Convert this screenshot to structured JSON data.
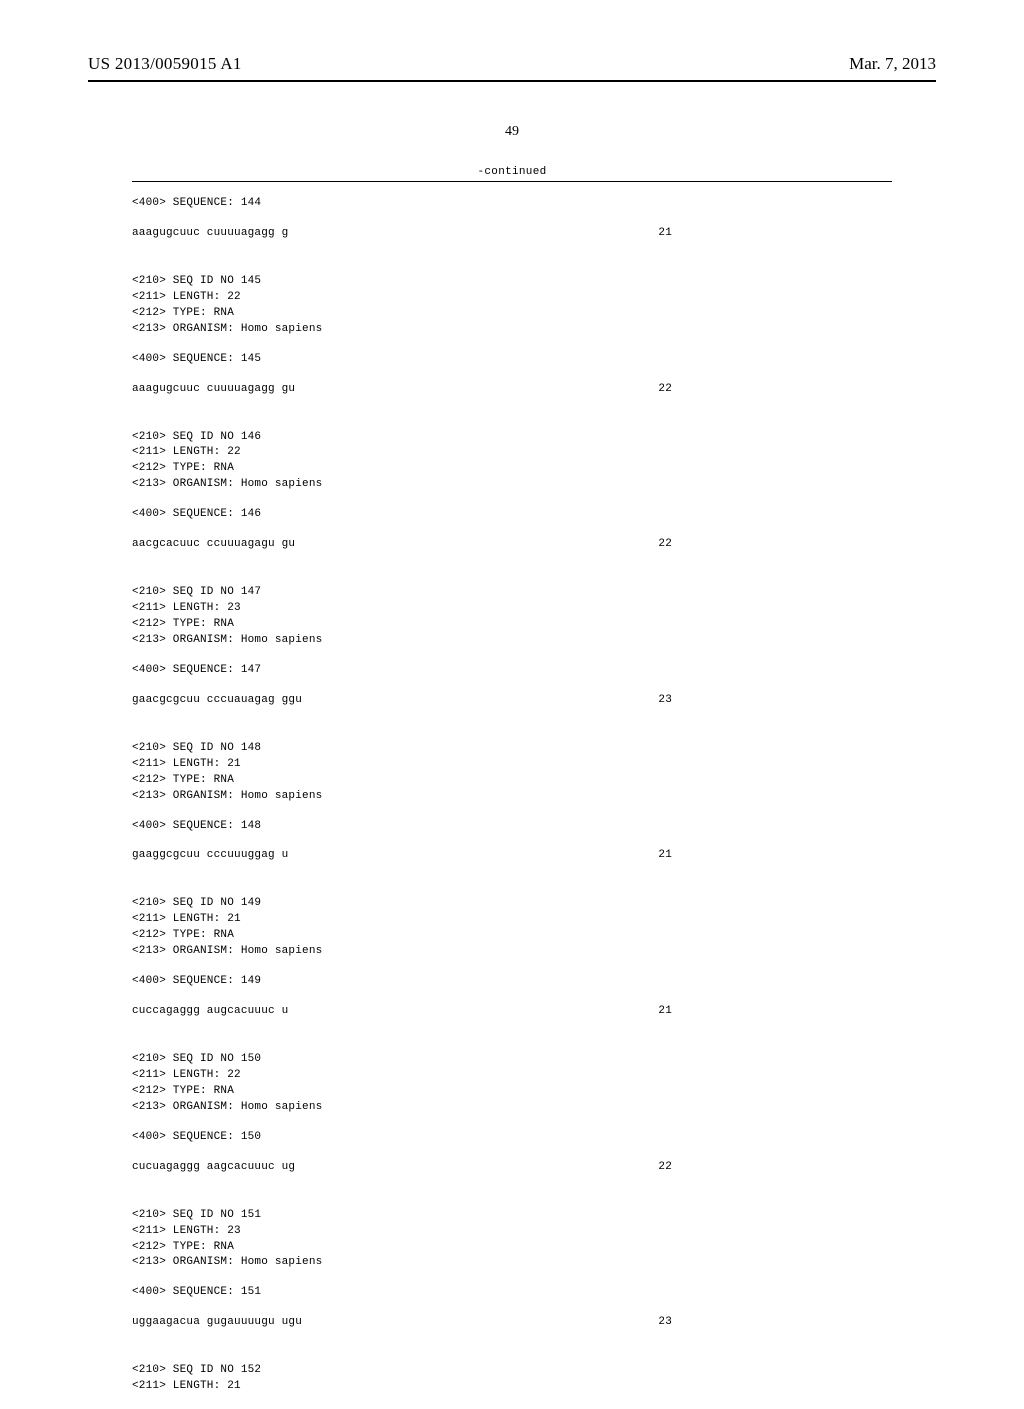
{
  "header": {
    "publication_number": "US 2013/0059015 A1",
    "publication_date": "Mar. 7, 2013"
  },
  "page_number": "49",
  "continued_label": "-continued",
  "entries": [
    {
      "seq_400_header": "<400> SEQUENCE: 144",
      "sequence_text": "aaagugcuuc cuuuuagagg g",
      "sequence_length": "21"
    },
    {
      "meta": [
        "<210> SEQ ID NO 145",
        "<211> LENGTH: 22",
        "<212> TYPE: RNA",
        "<213> ORGANISM: Homo sapiens"
      ],
      "seq_400_header": "<400> SEQUENCE: 145",
      "sequence_text": "aaagugcuuc cuuuuagagg gu",
      "sequence_length": "22"
    },
    {
      "meta": [
        "<210> SEQ ID NO 146",
        "<211> LENGTH: 22",
        "<212> TYPE: RNA",
        "<213> ORGANISM: Homo sapiens"
      ],
      "seq_400_header": "<400> SEQUENCE: 146",
      "sequence_text": "aacgcacuuc ccuuuagagu gu",
      "sequence_length": "22"
    },
    {
      "meta": [
        "<210> SEQ ID NO 147",
        "<211> LENGTH: 23",
        "<212> TYPE: RNA",
        "<213> ORGANISM: Homo sapiens"
      ],
      "seq_400_header": "<400> SEQUENCE: 147",
      "sequence_text": "gaacgcgcuu cccuauagag ggu",
      "sequence_length": "23"
    },
    {
      "meta": [
        "<210> SEQ ID NO 148",
        "<211> LENGTH: 21",
        "<212> TYPE: RNA",
        "<213> ORGANISM: Homo sapiens"
      ],
      "seq_400_header": "<400> SEQUENCE: 148",
      "sequence_text": "gaaggcgcuu cccuuuggag u",
      "sequence_length": "21"
    },
    {
      "meta": [
        "<210> SEQ ID NO 149",
        "<211> LENGTH: 21",
        "<212> TYPE: RNA",
        "<213> ORGANISM: Homo sapiens"
      ],
      "seq_400_header": "<400> SEQUENCE: 149",
      "sequence_text": "cuccagaggg augcacuuuc u",
      "sequence_length": "21"
    },
    {
      "meta": [
        "<210> SEQ ID NO 150",
        "<211> LENGTH: 22",
        "<212> TYPE: RNA",
        "<213> ORGANISM: Homo sapiens"
      ],
      "seq_400_header": "<400> SEQUENCE: 150",
      "sequence_text": "cucuagaggg aagcacuuuc ug",
      "sequence_length": "22"
    },
    {
      "meta": [
        "<210> SEQ ID NO 151",
        "<211> LENGTH: 23",
        "<212> TYPE: RNA",
        "<213> ORGANISM: Homo sapiens"
      ],
      "seq_400_header": "<400> SEQUENCE: 151",
      "sequence_text": "uggaagacua gugauuuugu ugu",
      "sequence_length": "23"
    },
    {
      "meta": [
        "<210> SEQ ID NO 152",
        "<211> LENGTH: 21"
      ]
    }
  ]
}
